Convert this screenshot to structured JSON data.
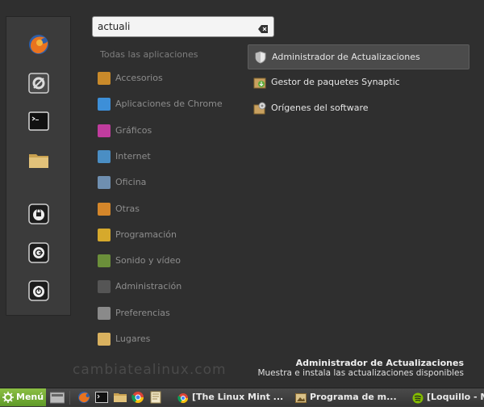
{
  "search": {
    "value": "actuali",
    "placeholder": ""
  },
  "categories_header": "Todas las aplicaciones",
  "categories": [
    {
      "label": "Accesorios",
      "icon": "accessories-icon",
      "color": "#c98a2a"
    },
    {
      "label": "Aplicaciones de Chrome",
      "icon": "chrome-icon",
      "color": "#3d8fd8"
    },
    {
      "label": "Gráficos",
      "icon": "graphics-icon",
      "color": "#c03c9e"
    },
    {
      "label": "Internet",
      "icon": "internet-icon",
      "color": "#4a8ec4"
    },
    {
      "label": "Oficina",
      "icon": "office-icon",
      "color": "#6f8fb0"
    },
    {
      "label": "Otras",
      "icon": "other-icon",
      "color": "#d4862a"
    },
    {
      "label": "Programación",
      "icon": "programming-icon",
      "color": "#d6a92c"
    },
    {
      "label": "Sonido y vídeo",
      "icon": "multimedia-icon",
      "color": "#6b8f3a"
    },
    {
      "label": "Administración",
      "icon": "administration-icon",
      "color": "#555555"
    },
    {
      "label": "Preferencias",
      "icon": "preferences-icon",
      "color": "#8a8a8a"
    },
    {
      "label": "Lugares",
      "icon": "folder-icon",
      "color": "#d9b15f"
    }
  ],
  "results": [
    {
      "label": "Administrador de Actualizaciones",
      "icon": "shield-icon"
    },
    {
      "label": "Gestor de paquetes Synaptic",
      "icon": "package-icon"
    },
    {
      "label": "Orígenes del software",
      "icon": "software-sources-icon"
    }
  ],
  "description": {
    "title": "Administrador de Actualizaciones",
    "text": "Muestra e instala las actualizaciones disponibles"
  },
  "watermark": "cambiatealinux.com",
  "favorites": [
    "firefox-icon",
    "settings-icon",
    "terminal-icon",
    "folder-icon",
    "lock-screen-icon",
    "logout-icon",
    "power-icon"
  ],
  "taskbar": {
    "menu_label": "Menú",
    "launchers": [
      "files-icon",
      "firefox-icon",
      "terminal-icon",
      "folder-icon",
      "chrome-icon",
      "text-editor-icon"
    ],
    "windows": [
      {
        "label": "[The Linux Mint ...",
        "icon": "chrome-icon"
      },
      {
        "label": "Programa de m...",
        "icon": "image-viewer-icon"
      },
      {
        "label": "[Loquillo - M",
        "icon": "spotify-icon"
      }
    ]
  }
}
